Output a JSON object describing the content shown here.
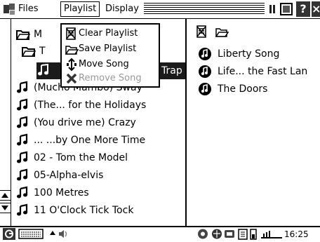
{
  "menubar": {
    "menus": [
      "Files",
      "Playlist",
      "Display"
    ],
    "help_label": "?",
    "close_label": "×"
  },
  "left_pane": {
    "rows": [
      {
        "icon": "folder-open-icon",
        "label": "M"
      },
      {
        "icon": "folder-icon",
        "label": "T"
      },
      {
        "icon": "music-note-icon",
        "label": "Trap",
        "selected": true
      },
      {
        "icon": "music-note-icon",
        "label": "(Mucho Mambo) Sway"
      },
      {
        "icon": "music-note-icon",
        "label": "(The... for the Holidays"
      },
      {
        "icon": "music-note-icon",
        "label": "(You drive me) Crazy"
      },
      {
        "icon": "music-note-icon",
        "label": "... ...by One More Time"
      },
      {
        "icon": "music-note-icon",
        "label": "02 - Tom the Model"
      },
      {
        "icon": "music-note-icon",
        "label": "05-Alpha-elvis"
      },
      {
        "icon": "music-note-icon",
        "label": "100 Metres"
      },
      {
        "icon": "music-note-icon",
        "label": "11 O'Clock Tick Tock"
      }
    ]
  },
  "playlist_menu": {
    "items": [
      {
        "label": "Clear Playlist",
        "icon": "clear-playlist-icon",
        "enabled": true
      },
      {
        "label": "Save Playlist",
        "icon": "save-playlist-icon",
        "enabled": true
      },
      {
        "label": "Move Song",
        "icon": "move-song-icon",
        "enabled": true
      },
      {
        "label": "Remove Song",
        "icon": "remove-song-icon",
        "enabled": false
      }
    ]
  },
  "right_pane": {
    "items": [
      {
        "icon": "cd-icon",
        "label": "Liberty Song"
      },
      {
        "icon": "cd-icon",
        "label": "Life... the Fast Lan"
      },
      {
        "icon": "cd-icon",
        "label": "The Doors"
      }
    ]
  },
  "statusbar": {
    "time": "16:25"
  },
  "colors": {
    "selection": "#1a1a1a",
    "disabled": "#999999"
  }
}
